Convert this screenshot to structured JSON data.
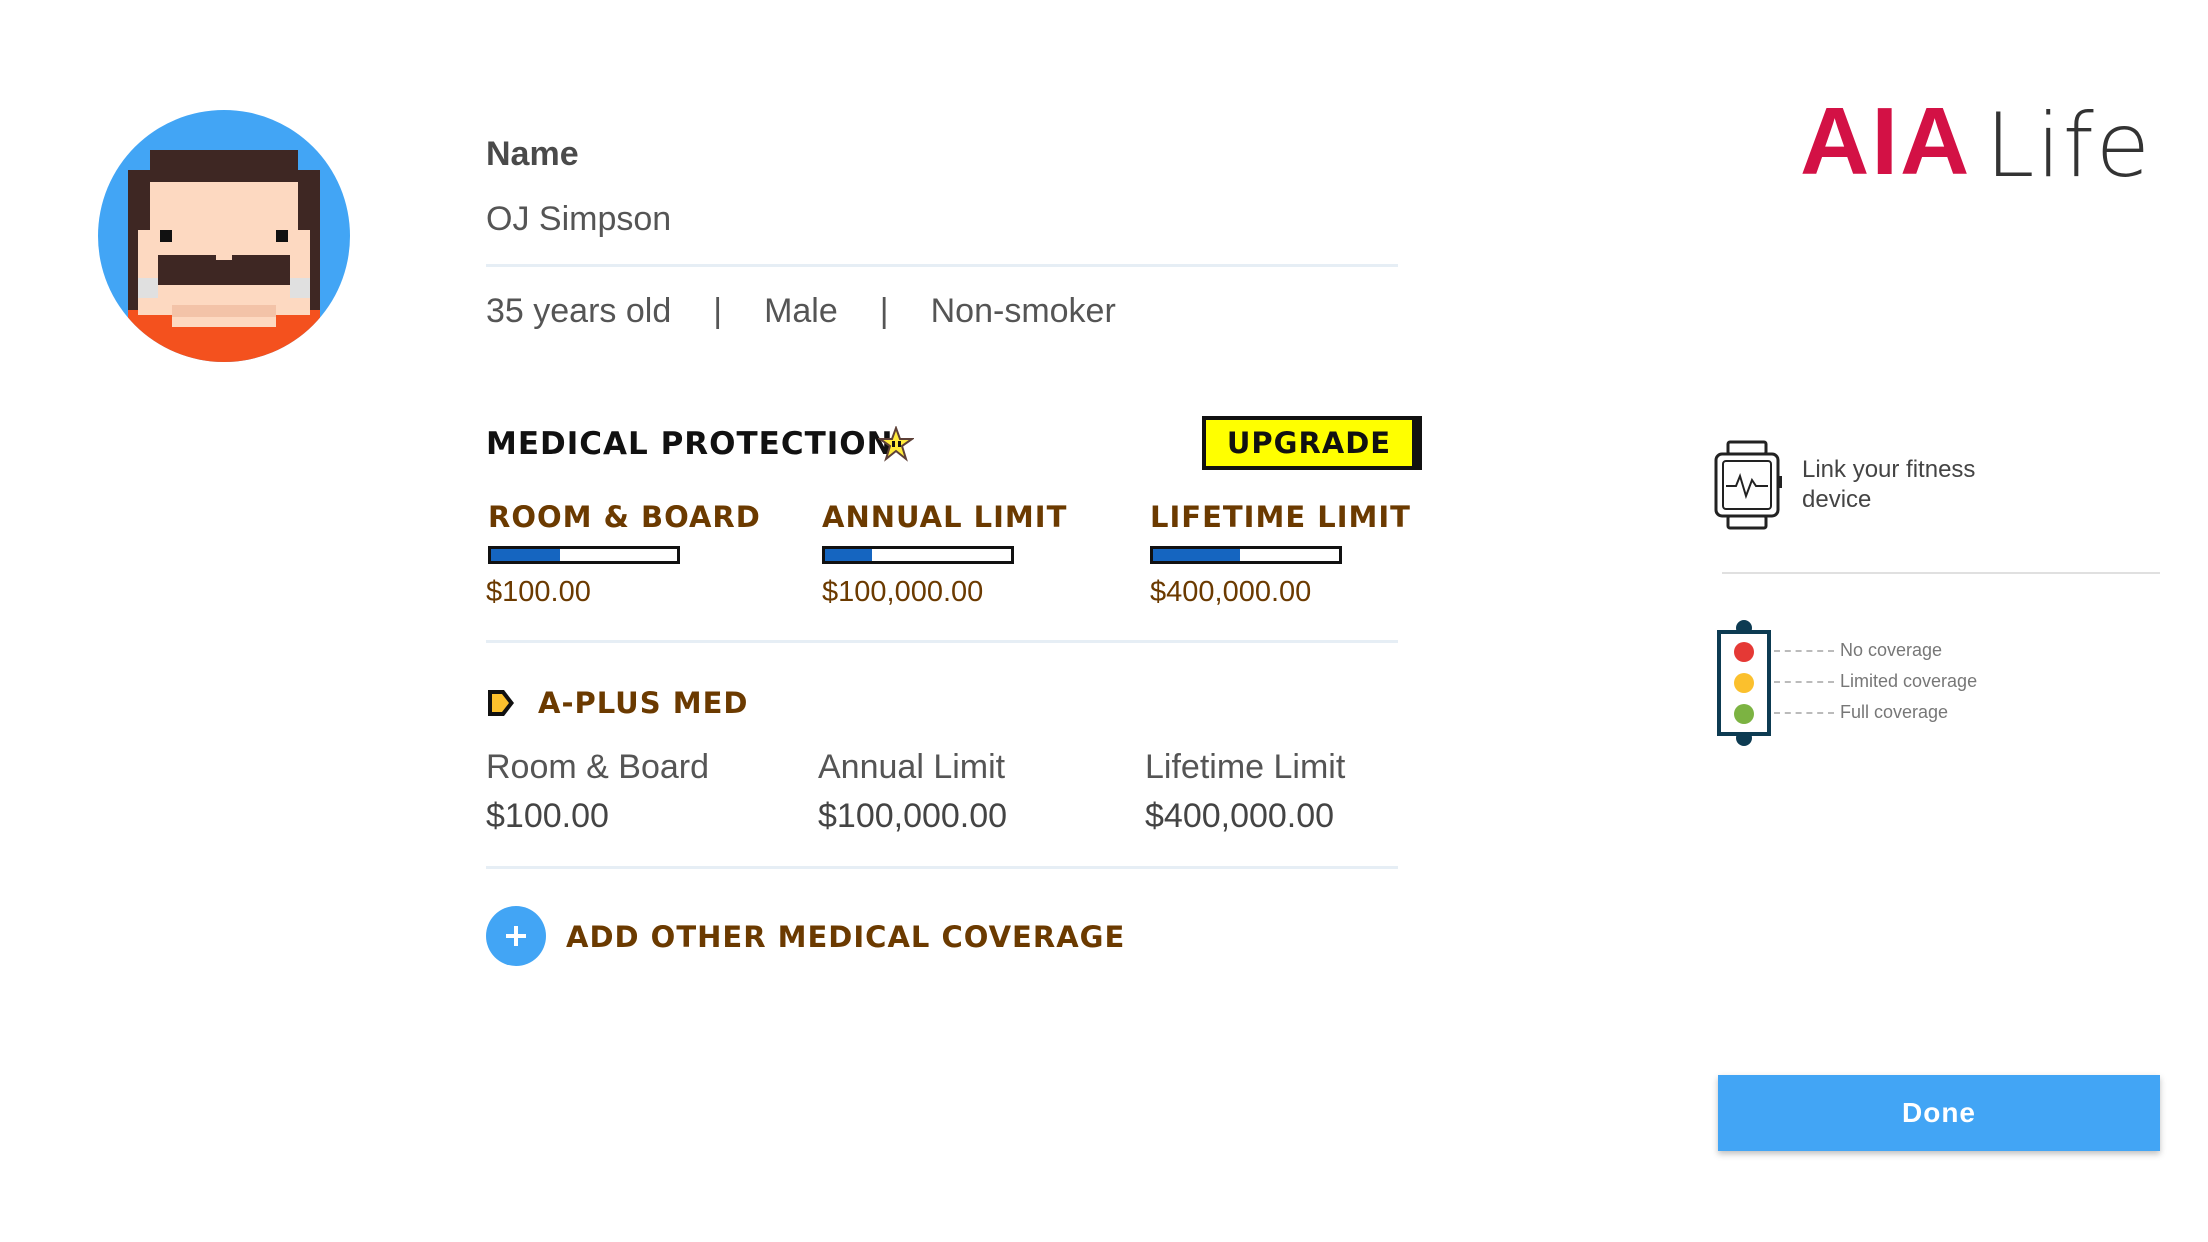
{
  "brand": {
    "logo_primary": "AIA",
    "logo_secondary": "Life",
    "primary_color": "#d31145"
  },
  "profile": {
    "name_label": "Name",
    "name_value": "OJ Simpson",
    "age": "35 years old",
    "separator": "|",
    "gender": "Male",
    "smoker_status": "Non-smoker"
  },
  "medical_protection": {
    "title": "MEDICAL PROTECTION",
    "upgrade_label": "UPGRADE",
    "limits": [
      {
        "title": "ROOM & BOARD",
        "amount": "$100.00",
        "fill_fraction": 0.37
      },
      {
        "title": "ANNUAL LIMIT",
        "amount": "$100,000.00",
        "fill_fraction": 0.25
      },
      {
        "title": "LIFETIME LIMIT",
        "amount": "$400,000.00",
        "fill_fraction": 0.47
      }
    ]
  },
  "plan": {
    "name": "A-PLUS MED",
    "details": [
      {
        "label": "Room & Board",
        "value": "$100.00"
      },
      {
        "label": "Annual Limit",
        "value": "$100,000.00"
      },
      {
        "label": "Lifetime Limit",
        "value": "$400,000.00"
      }
    ]
  },
  "add_coverage": {
    "label": "ADD OTHER MEDICAL COVERAGE"
  },
  "fitness": {
    "link_text": "Link your fitness device"
  },
  "legend": {
    "items": [
      {
        "label": "No coverage",
        "color": "#e53935"
      },
      {
        "label": "Limited coverage",
        "color": "#fbc02d"
      },
      {
        "label": "Full coverage",
        "color": "#7cb342"
      }
    ]
  },
  "actions": {
    "done_label": "Done"
  }
}
